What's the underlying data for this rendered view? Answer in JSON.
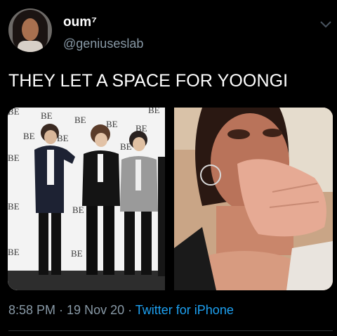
{
  "author": {
    "display_name": "oum⁷",
    "handle": "@geniuseslab"
  },
  "tweet": {
    "text": "THEY LET A SPACE FOR YOONGI"
  },
  "backdrop": {
    "logo_text": "BE"
  },
  "meta": {
    "time": "8:58 PM",
    "separator": " · ",
    "date": "19 Nov 20",
    "source": "Twitter for iPhone"
  },
  "colors": {
    "background": "#000000",
    "text": "#ffffff",
    "secondary_text": "#8899a6",
    "link": "#1da1f2"
  },
  "icons": {
    "menu": "chevron-down-icon"
  }
}
